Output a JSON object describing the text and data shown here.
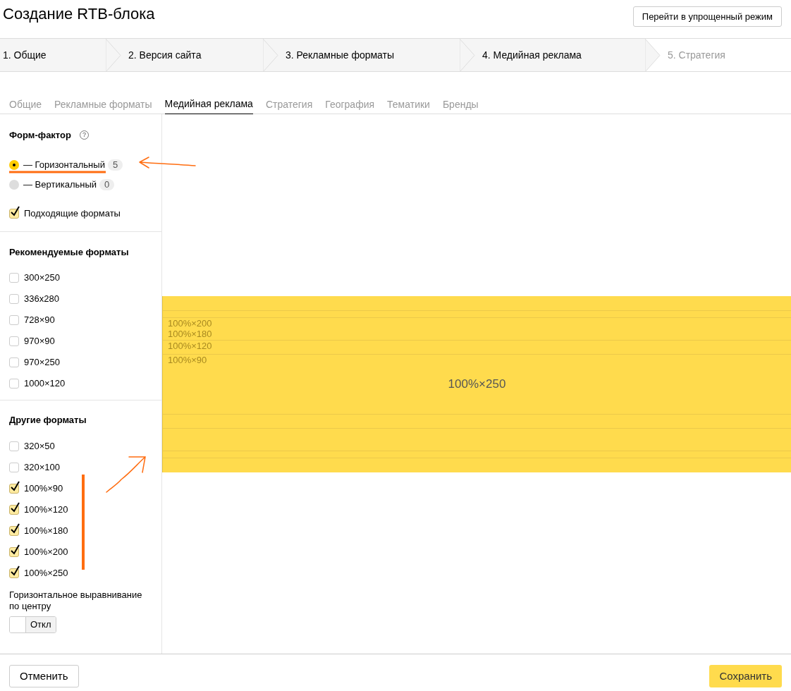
{
  "title": "Создание RTB-блока",
  "simple_mode_button": "Перейти в упрощенный режим",
  "steps": [
    {
      "label": "1. Общие",
      "disabled": false
    },
    {
      "label": "2. Версия сайта",
      "disabled": false
    },
    {
      "label": "3. Рекламные форматы",
      "disabled": false
    },
    {
      "label": "4. Медийная реклама",
      "disabled": false
    },
    {
      "label": "5. Стратегия",
      "disabled": true
    }
  ],
  "tabs": [
    {
      "label": "Общие",
      "selected": false
    },
    {
      "label": "Рекламные форматы",
      "selected": false
    },
    {
      "label": "Медийная реклама",
      "selected": true
    },
    {
      "label": "Стратегия",
      "selected": false
    },
    {
      "label": "География",
      "selected": false
    },
    {
      "label": "Тематики",
      "selected": false
    },
    {
      "label": "Бренды",
      "selected": false
    }
  ],
  "form_factor": {
    "heading": "Форм-фактор",
    "help_icon": "?",
    "options": [
      {
        "label": "— Горизонтальный",
        "count": "5",
        "selected": true
      },
      {
        "label": "— Вертикальный",
        "count": "0",
        "selected": false
      }
    ],
    "suitable": {
      "label": "Подходящие форматы",
      "checked": true
    }
  },
  "recommended": {
    "heading": "Рекомендуемые форматы",
    "formats": [
      {
        "label": "300×250",
        "checked": false
      },
      {
        "label": "336x280",
        "checked": false
      },
      {
        "label": "728×90",
        "checked": false
      },
      {
        "label": "970×90",
        "checked": false
      },
      {
        "label": "970×250",
        "checked": false
      },
      {
        "label": "1000×120",
        "checked": false
      }
    ]
  },
  "other": {
    "heading": "Другие форматы",
    "formats": [
      {
        "label": "320×50",
        "checked": false
      },
      {
        "label": "320×100",
        "checked": false
      },
      {
        "label": "100%×90",
        "checked": true
      },
      {
        "label": "100%×120",
        "checked": true
      },
      {
        "label": "100%×180",
        "checked": true
      },
      {
        "label": "100%×200",
        "checked": true
      },
      {
        "label": "100%×250",
        "checked": true
      }
    ]
  },
  "alignment": {
    "label": "Горизонтальное выравнивание по центру",
    "toggle": "Откл",
    "on": false
  },
  "preview": {
    "main_label": "100%×250",
    "layers": [
      {
        "label": "100%×200"
      },
      {
        "label": "100%×180"
      },
      {
        "label": "100%×120"
      },
      {
        "label": "100%×90"
      }
    ]
  },
  "footer": {
    "cancel": "Отменить",
    "save": "Сохранить"
  }
}
